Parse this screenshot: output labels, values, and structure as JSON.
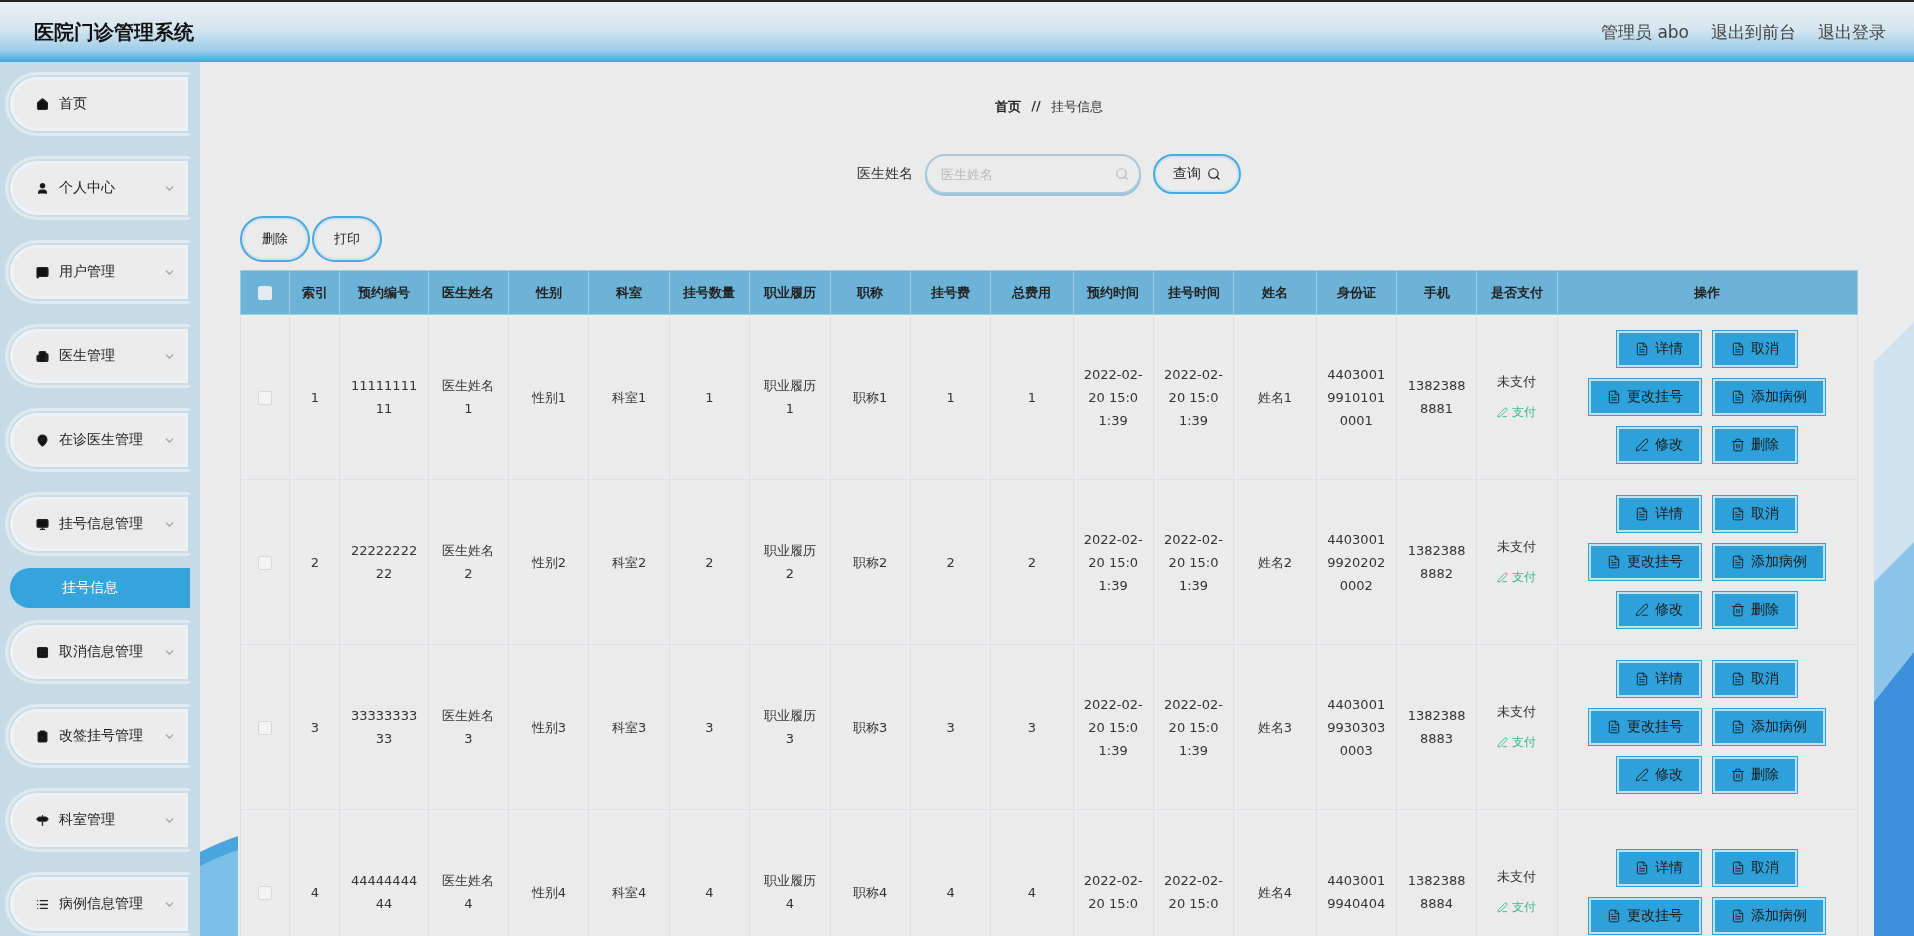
{
  "header": {
    "title": "医院门诊管理系统",
    "user": "管理员 abo",
    "links": [
      "退出到前台",
      "退出登录"
    ]
  },
  "sidebar": {
    "items": [
      {
        "label": "首页",
        "expandable": false
      },
      {
        "label": "个人中心",
        "expandable": true
      },
      {
        "label": "用户管理",
        "expandable": true
      },
      {
        "label": "医生管理",
        "expandable": true
      },
      {
        "label": "在诊医生管理",
        "expandable": true
      },
      {
        "label": "挂号信息管理",
        "expandable": true,
        "children": [
          {
            "label": "挂号信息",
            "selected": true
          }
        ]
      },
      {
        "label": "取消信息管理",
        "expandable": true
      },
      {
        "label": "改签挂号管理",
        "expandable": true
      },
      {
        "label": "科室管理",
        "expandable": true
      },
      {
        "label": "病例信息管理",
        "expandable": true
      }
    ]
  },
  "breadcrumb": {
    "items": [
      "首页",
      "挂号信息"
    ],
    "separator": "//"
  },
  "search": {
    "label": "医生姓名",
    "placeholder": "医生姓名",
    "button": "查询"
  },
  "toolbar": [
    "删除",
    "打印"
  ],
  "table": {
    "all_checked": false,
    "columns": [
      "索引",
      "预约编号",
      "医生姓名",
      "性别",
      "科室",
      "挂号数量",
      "职业履历",
      "职称",
      "挂号费",
      "总费用",
      "预约时间",
      "挂号时间",
      "姓名",
      "身份证",
      "手机",
      "是否支付",
      "操作"
    ],
    "rows": [
      {
        "checked": false,
        "cells": [
          "1",
          "1111111111",
          "医生姓名1",
          "性别1",
          "科室1",
          "1",
          "职业履历1",
          "职称1",
          "1",
          "1",
          "2022-02-20 15:01:39",
          "2022-02-20 15:01:39",
          "姓名1",
          "440300199101010001",
          "13823888881"
        ],
        "payment": "未支付",
        "pay_link": "支付",
        "actions": [
          {
            "label": "详情",
            "kind": "doc"
          },
          {
            "label": "取消",
            "kind": "doc"
          },
          {
            "label": "更改挂号",
            "kind": "doc"
          },
          {
            "label": "添加病例",
            "kind": "doc"
          },
          {
            "label": "修改",
            "kind": "edit"
          },
          {
            "label": "删除",
            "kind": "delete"
          }
        ]
      },
      {
        "checked": false,
        "cells": [
          "2",
          "2222222222",
          "医生姓名2",
          "性别2",
          "科室2",
          "2",
          "职业履历2",
          "职称2",
          "2",
          "2",
          "2022-02-20 15:01:39",
          "2022-02-20 15:01:39",
          "姓名2",
          "440300199202020002",
          "13823888882"
        ],
        "payment": "未支付",
        "pay_link": "支付",
        "actions": [
          {
            "label": "详情",
            "kind": "doc"
          },
          {
            "label": "取消",
            "kind": "doc"
          },
          {
            "label": "更改挂号",
            "kind": "doc"
          },
          {
            "label": "添加病例",
            "kind": "doc"
          },
          {
            "label": "修改",
            "kind": "edit"
          },
          {
            "label": "删除",
            "kind": "delete"
          }
        ]
      },
      {
        "checked": false,
        "cells": [
          "3",
          "3333333333",
          "医生姓名3",
          "性别3",
          "科室3",
          "3",
          "职业履历3",
          "职称3",
          "3",
          "3",
          "2022-02-20 15:01:39",
          "2022-02-20 15:01:39",
          "姓名3",
          "440300199303030003",
          "13823888883"
        ],
        "payment": "未支付",
        "pay_link": "支付",
        "actions": [
          {
            "label": "详情",
            "kind": "doc"
          },
          {
            "label": "取消",
            "kind": "doc"
          },
          {
            "label": "更改挂号",
            "kind": "doc"
          },
          {
            "label": "添加病例",
            "kind": "doc"
          },
          {
            "label": "修改",
            "kind": "edit"
          },
          {
            "label": "删除",
            "kind": "delete"
          }
        ]
      },
      {
        "checked": false,
        "cells": [
          "4",
          "4444444444",
          "医生姓名4",
          "性别4",
          "科室4",
          "4",
          "职业履历4",
          "职称4",
          "4",
          "4",
          "2022-02-20 15:0",
          "2022-02-20 15:0",
          "姓名4",
          "44030019940404",
          "13823888884"
        ],
        "payment": "未支付",
        "pay_link": "支付",
        "actions": [
          {
            "label": "详情",
            "kind": "doc"
          },
          {
            "label": "取消",
            "kind": "doc"
          },
          {
            "label": "更改挂号",
            "kind": "doc"
          },
          {
            "label": "添加病例",
            "kind": "doc"
          }
        ]
      }
    ]
  }
}
